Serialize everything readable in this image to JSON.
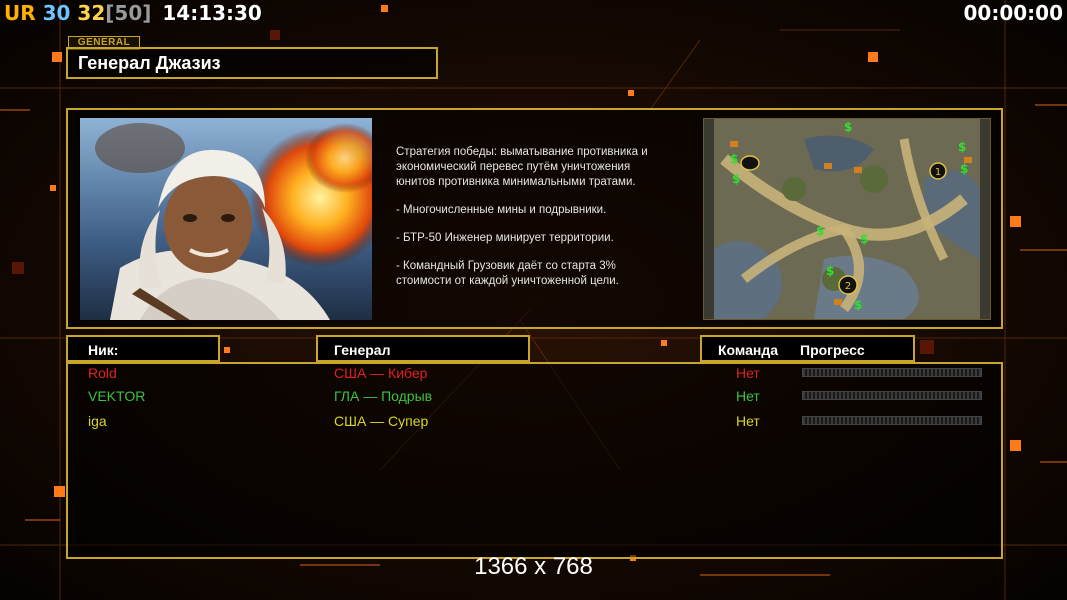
{
  "hud": {
    "ur_label": "UR",
    "fps_a": "30",
    "fps_b": "32",
    "fps_cap": "[50]",
    "clock": "14:13:30",
    "game_timer": "00:00:00"
  },
  "colors": {
    "gold_border": "#c9a52a",
    "player_red": "#e02020",
    "player_green": "#3cc23c",
    "player_yellow": "#d8d820"
  },
  "general_section": {
    "tag": "GENERAL",
    "name": "Генерал Джазиз",
    "description": [
      "Стратегия победы: выматывание противника и\n экономический перевес путём уничтожения\n юнитов противника минимальными тратами.",
      "- Многочисленные мины и подрывники.",
      "- БТР-50 Инженер минирует территории.",
      "- Командный Грузовик даёт со старта 3%\n стоимости от каждой уничтоженной цели."
    ],
    "map_markers": [
      "1",
      "2"
    ]
  },
  "players_table": {
    "headers": {
      "nick": "Ник:",
      "general": "Генерал",
      "team": "Команда",
      "progress": "Прогресс"
    },
    "rows": [
      {
        "nick": "Rold",
        "general": "США — Кибер",
        "team": "Нет",
        "color": "#e02020",
        "progress": 0
      },
      {
        "nick": "VEKTOR",
        "general": "ГЛА — Подрыв",
        "team": "Нет",
        "color": "#3cc23c",
        "progress": 0
      },
      {
        "nick": "iga",
        "general": "США — Супер",
        "team": "Нет",
        "color": "#d8d820",
        "progress": 0
      }
    ]
  },
  "resolution_text": "1366 x 768"
}
